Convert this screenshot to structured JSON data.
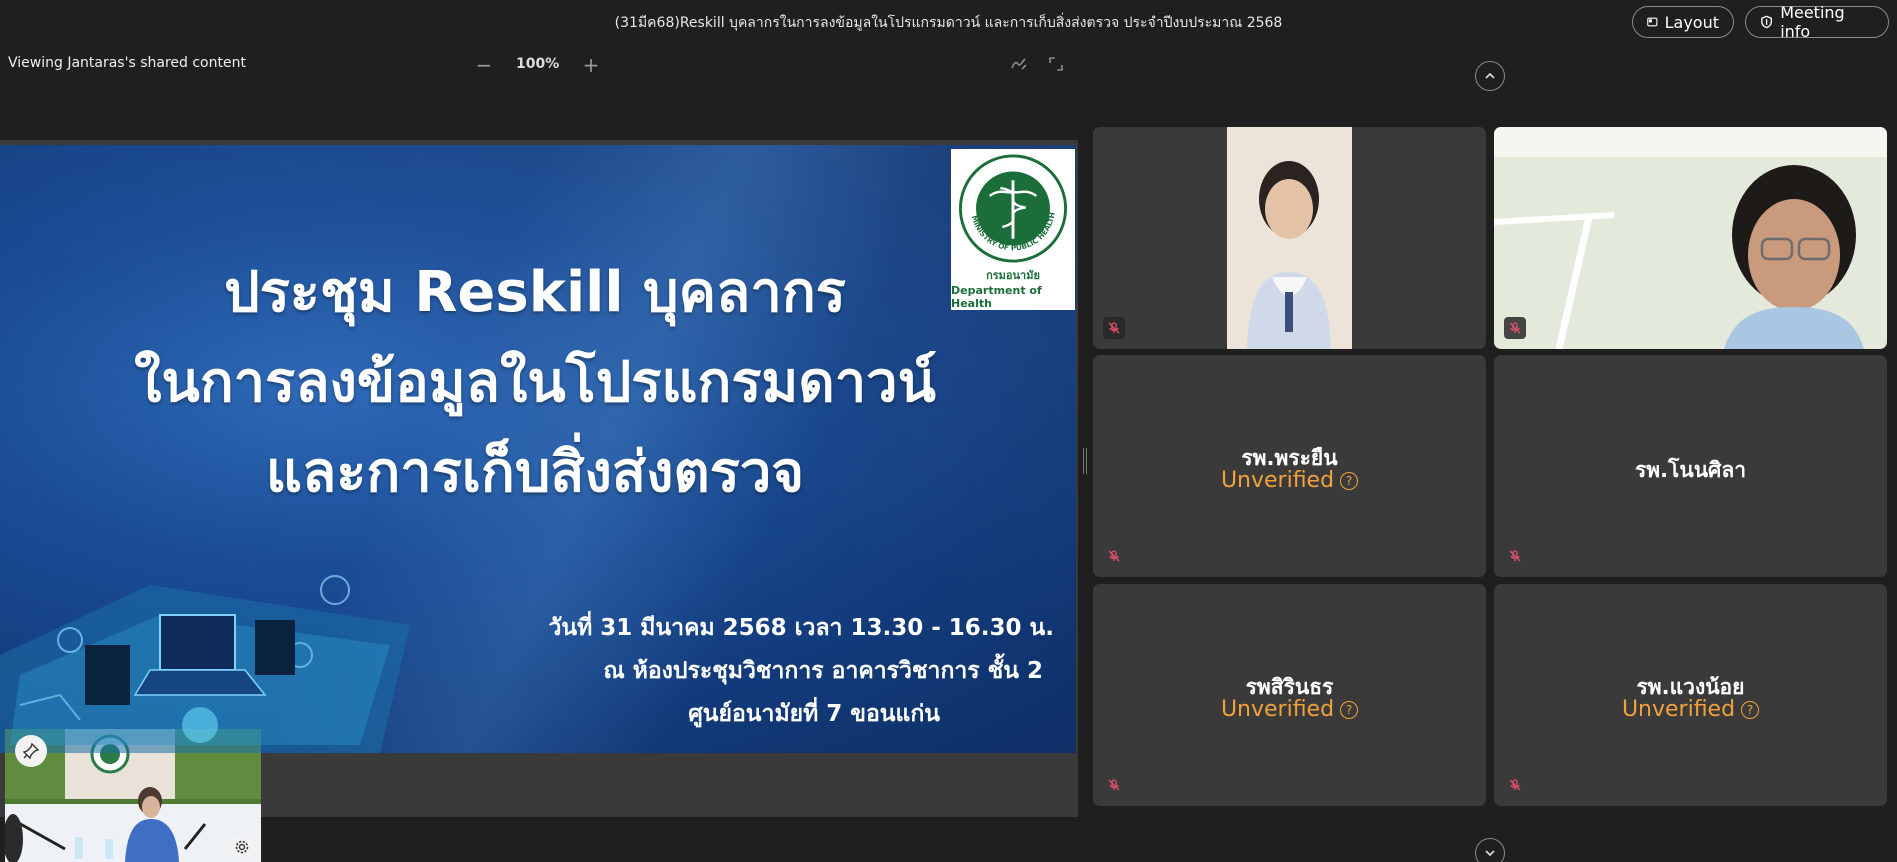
{
  "meeting": {
    "title": "(31มีค68)Reskill บุคลากรในการลงข้อมูลในโปรแกรมดาวน์ และการเก็บสิ่งส่งตรวจ ประจำปีงบประมาณ 2568",
    "layout_label": "Layout",
    "info_label": "Meeting info"
  },
  "share_toolbar": {
    "viewing_label": "Viewing Jantaras's shared content",
    "zoom_level": "100%",
    "zoom_out": "−",
    "zoom_in": "+"
  },
  "slide": {
    "title_line1": "ประชุม Reskill บุคลากร",
    "title_line2": "ในการลงข้อมูลในโปรแกรมดาวน์",
    "title_line3": "และการเก็บสิ่งส่งตรวจ",
    "date_line": "วันที่ 31 มีนาคม 2568 เวลา 13.30 - 16.30 น.",
    "venue_line": "ณ ห้องประชุมวิชาการ อาคารวิชาการ ชั้น 2",
    "center_line": "ศูนย์อนามัยที่ 7 ขอนแก่น",
    "logo_th": "กรมอนามัย",
    "logo_en": "Department of Health",
    "seal_text": "MINISTRY OF PUBLIC HEALTH"
  },
  "participants": [
    {
      "name": "",
      "video": true,
      "muted": true
    },
    {
      "name": "",
      "video": true,
      "muted": true
    },
    {
      "name": "รพ.พระยืน",
      "status": "Unverified",
      "muted": true
    },
    {
      "name": "รพ.โนนศิลา",
      "status": "",
      "muted": true
    },
    {
      "name": "รพสิรินธร",
      "status": "Unverified",
      "muted": true
    },
    {
      "name": "รพ.แวงน้อย",
      "status": "Unverified",
      "muted": true
    }
  ],
  "colors": {
    "background": "#1f1f1f",
    "tile": "#3a3a3a",
    "unverified": "#f2a23a",
    "muted_icon": "#e0506a"
  }
}
